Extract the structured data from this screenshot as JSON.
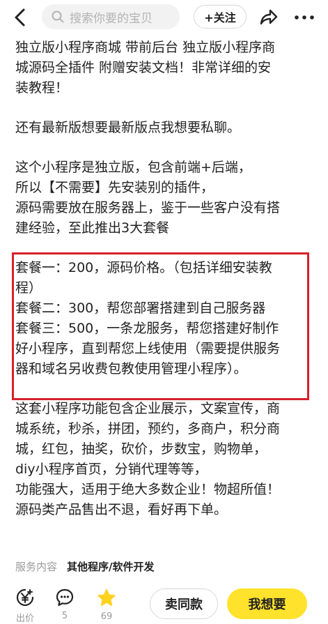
{
  "header": {
    "search_placeholder": "搜索你要的宝贝",
    "follow_label": "+关注"
  },
  "description": {
    "title_lines": [
      "独立版小程序商城 带前后台 独立版小程序商",
      "城源码全插件 附赠安装文档！非常详细的安",
      "装教程！"
    ],
    "contact_line": "还有最新版想要最新版点我想要私聊。",
    "intro_lines": [
      "这个小程序是独立版，包含前端+后端，",
      "所以【不需要】先安装别的插件，",
      "源码需要放在服务器上，鉴于一些客户没有搭",
      "建经验，至此推出3大套餐"
    ],
    "package_lines": [
      "套餐一：200，源码价格。（包括详细安装教",
      "程）",
      "套餐二：300，帮您部署搭建到自己服务器",
      "套餐三：500，一条龙服务，帮您搭建好制作",
      "好小程序，直到帮您上线使用（需要提供服务",
      "器和域名另收费包教使用管理小程序）。"
    ],
    "feature_lines": [
      "这套小程序功能包含企业展示，文案宣传，商",
      "城系统，秒杀，拼团，预约，多商户，积分商",
      "城，红包，抽奖，砍价，步数宝，购物单，",
      "diy小程序首页，分销代理等等，",
      "功能强大，适用于绝大多数企业！物超所值！",
      "源码类产品售出不退，看好再下单。"
    ]
  },
  "service": {
    "label": "服务内容",
    "value": "其他程序/软件开发"
  },
  "footer": {
    "price_label": "出价",
    "comment_count": "5",
    "favorite_count": "69",
    "sell_similar_label": "卖同款",
    "want_label": "我想要"
  },
  "colors": {
    "accent_yellow": "#ffe22b",
    "highlight_border": "#d8202a",
    "favorite_star": "#ffd21f"
  }
}
